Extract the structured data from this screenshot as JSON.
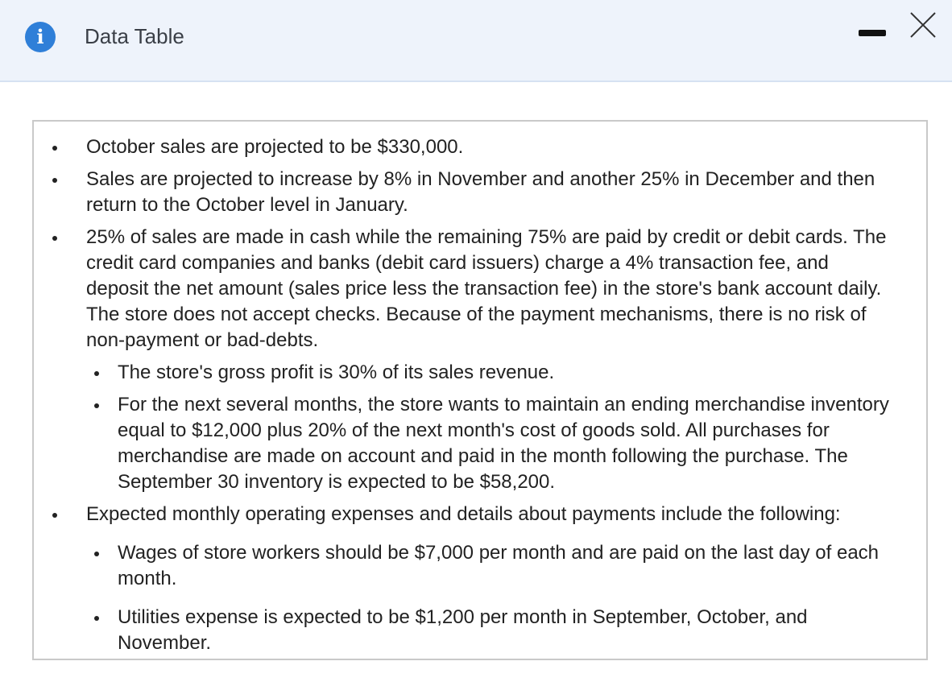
{
  "window": {
    "title": "Data Table",
    "info_icon_glyph": "i",
    "icons": [
      "info-icon",
      "minimize-icon",
      "close-icon"
    ],
    "accent_color": "#2f7fd8",
    "titlebar_color": "#eef3fb"
  },
  "content": {
    "items": [
      {
        "text": "October sales are projected to be $330,000."
      },
      {
        "text": "Sales are projected to increase by 8% in November and another 25% in December and then return to the October level in January."
      },
      {
        "text": "25% of sales are made in cash while the remaining 75% are paid by credit or debit cards. The credit card companies and banks (debit card issuers) charge a 4% transaction fee, and deposit the net amount (sales price less the transaction fee) in the store's bank account daily. The store does not accept checks.  Because of the payment mechanisms, there is no risk of non-payment or bad-debts.",
        "subitems": [
          "The store's gross profit is 30% of its sales revenue.",
          "For the next several months, the store wants to maintain an ending merchandise inventory equal to $12,000 plus 20% of the next month's cost of goods sold. All purchases for merchandise are made on account and paid in the month following the purchase. The September 30 inventory is expected to be $58,200."
        ]
      },
      {
        "text": "Expected monthly operating expenses and details about payments include the following:",
        "subitems": [
          "Wages of store workers should be $7,000 per month and are paid on the last day of each month.",
          "Utilities expense is expected to be $1,200 per month in September, October, and November."
        ]
      }
    ]
  }
}
